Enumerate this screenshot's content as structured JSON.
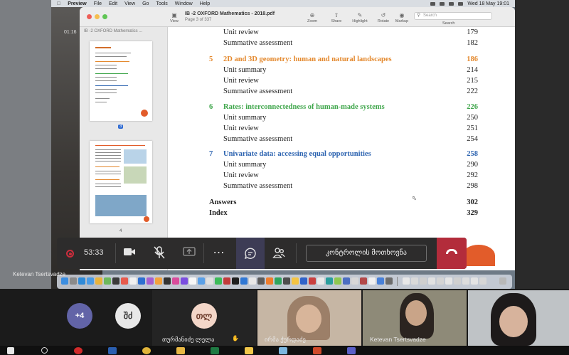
{
  "menubar": {
    "app": "Preview",
    "items": [
      "File",
      "Edit",
      "View",
      "Go",
      "Tools",
      "Window",
      "Help"
    ],
    "clock": "Wed 18 May  19:01"
  },
  "left_timer": "01:16",
  "preview": {
    "doc_title": "IB -2 OXFORD Mathematics - 2018.pdf",
    "doc_sub": "Page 3 of 337",
    "sidebar_title": "IB -2 OXFORD Mathematics ...",
    "toolbar": {
      "view": "View",
      "zoom": "Zoom",
      "share": "Share",
      "highlight": "Highlight",
      "rotate": "Rotate",
      "markup": "Markup",
      "search": "Search",
      "search_placeholder": "Search"
    },
    "thumb_pages": [
      "3",
      "4"
    ]
  },
  "toc": {
    "top_rows": [
      {
        "label": "Unit review",
        "page": "179"
      },
      {
        "label": "Summative assessment",
        "page": "182"
      }
    ],
    "sections": [
      {
        "num": "5",
        "title": "2D and 3D geometry: human and natural landscapes",
        "page": "186",
        "color": "#e4892e",
        "rows": [
          {
            "label": "Unit summary",
            "page": "214"
          },
          {
            "label": "Unit review",
            "page": "215"
          },
          {
            "label": "Summative assessment",
            "page": "222"
          }
        ]
      },
      {
        "num": "6",
        "title": "Rates: interconnectedness of human-made systems",
        "page": "226",
        "color": "#3fa64b",
        "rows": [
          {
            "label": "Unit summary",
            "page": "250"
          },
          {
            "label": "Unit review",
            "page": "251"
          },
          {
            "label": "Summative assessment",
            "page": "254"
          }
        ]
      },
      {
        "num": "7",
        "title": "Univariate data: accessing equal opportunities",
        "page": "258",
        "color": "#2c63b0",
        "rows": [
          {
            "label": "Unit summary",
            "page": "290"
          },
          {
            "label": "Unit review",
            "page": "292"
          },
          {
            "label": "Summative assessment",
            "page": "298"
          }
        ]
      }
    ],
    "end_rows": [
      {
        "label": "Answers",
        "page": "302"
      },
      {
        "label": "Index",
        "page": "329"
      }
    ]
  },
  "call": {
    "timer": "53:33",
    "ask_control": "კონტროლის მოთხოვნა",
    "presenter": "Ketevan Tsertsvadze",
    "accent": "#3d3c55",
    "hangup_color": "#b32c3b"
  },
  "participants": {
    "overflow": "+4",
    "p1_initials": "შძ",
    "p2_initials": "თლ",
    "p2_name": "თურმანიძე ლელა",
    "p3_name": "ირმა ქურდაძე",
    "p4_name": "Ketevan Tsertsvadze"
  }
}
